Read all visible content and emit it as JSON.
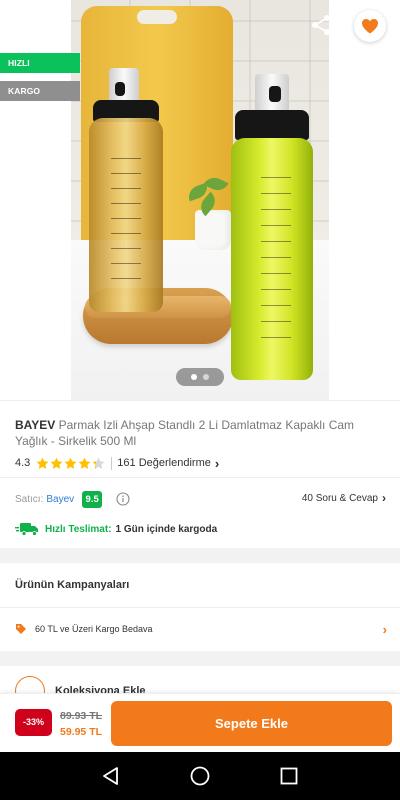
{
  "badges": {
    "fast": "HIZLI TESLİMAT",
    "free_shipping": "KARGO BEDAVA"
  },
  "gallery": {
    "pages": 2,
    "current_page": 1
  },
  "product": {
    "brand": "BAYEV",
    "name": "Parmak Izli Ahşap Standlı 2 Li Damlatmaz Kapaklı Cam Yağlık - Sirkelik 500 Ml",
    "rating": "4.3",
    "rating_value": 4.3,
    "review_count": "161 Değerlendirme"
  },
  "seller": {
    "label": "Satıcı:",
    "name": "Bayev",
    "score": "9.5"
  },
  "qa": {
    "label": "40 Soru & Cevap"
  },
  "shipping": {
    "label": "Hızlı Teslimat:",
    "text": "1 Gün içinde kargoda"
  },
  "campaigns": {
    "title": "Ürünün Kampanyaları",
    "items": [
      "60 TL ve Üzeri Kargo Bedava"
    ]
  },
  "collection": {
    "label": "Koleksiyona Ekle"
  },
  "price": {
    "discount": "-33%",
    "old": "89.93 TL",
    "new": "59.95 TL"
  },
  "cart": {
    "button_label": "Sepete Ekle"
  },
  "colors": {
    "accent": "#f27a1a",
    "green": "#10b14b",
    "discount_red": "#d0021b",
    "link_blue": "#2f7bd8"
  },
  "icons": [
    "back-arrow-icon",
    "share-icon",
    "heart-icon",
    "star-icon",
    "chevron-right-icon",
    "info-icon",
    "truck-icon",
    "tag-icon",
    "nav-back-icon",
    "nav-home-icon",
    "nav-recents-icon"
  ]
}
